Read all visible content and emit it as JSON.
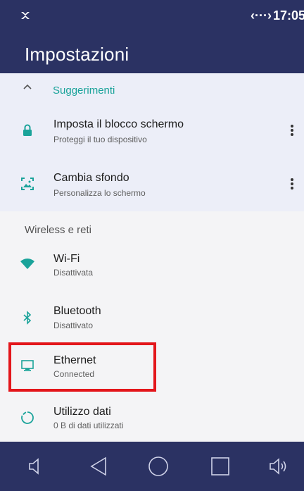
{
  "status": {
    "sync": "‹···›",
    "time": "17:05"
  },
  "appbar": {
    "title": "Impostazioni"
  },
  "suggestions": {
    "title": "Suggerimenti",
    "items": [
      {
        "title": "Imposta il blocco schermo",
        "subtitle": "Proteggi il tuo dispositivo"
      },
      {
        "title": "Cambia sfondo",
        "subtitle": "Personalizza lo schermo"
      }
    ]
  },
  "section": {
    "wireless": "Wireless e reti"
  },
  "items": [
    {
      "title": "Wi-Fi",
      "subtitle": "Disattivata"
    },
    {
      "title": "Bluetooth",
      "subtitle": "Disattivato"
    },
    {
      "title": "Ethernet",
      "subtitle": "Connected"
    },
    {
      "title": "Utilizzo dati",
      "subtitle": "0 B di dati utilizzati"
    }
  ],
  "colors": {
    "header": "#2b3263",
    "accent": "#1aa39a",
    "highlight": "#e3161b"
  }
}
